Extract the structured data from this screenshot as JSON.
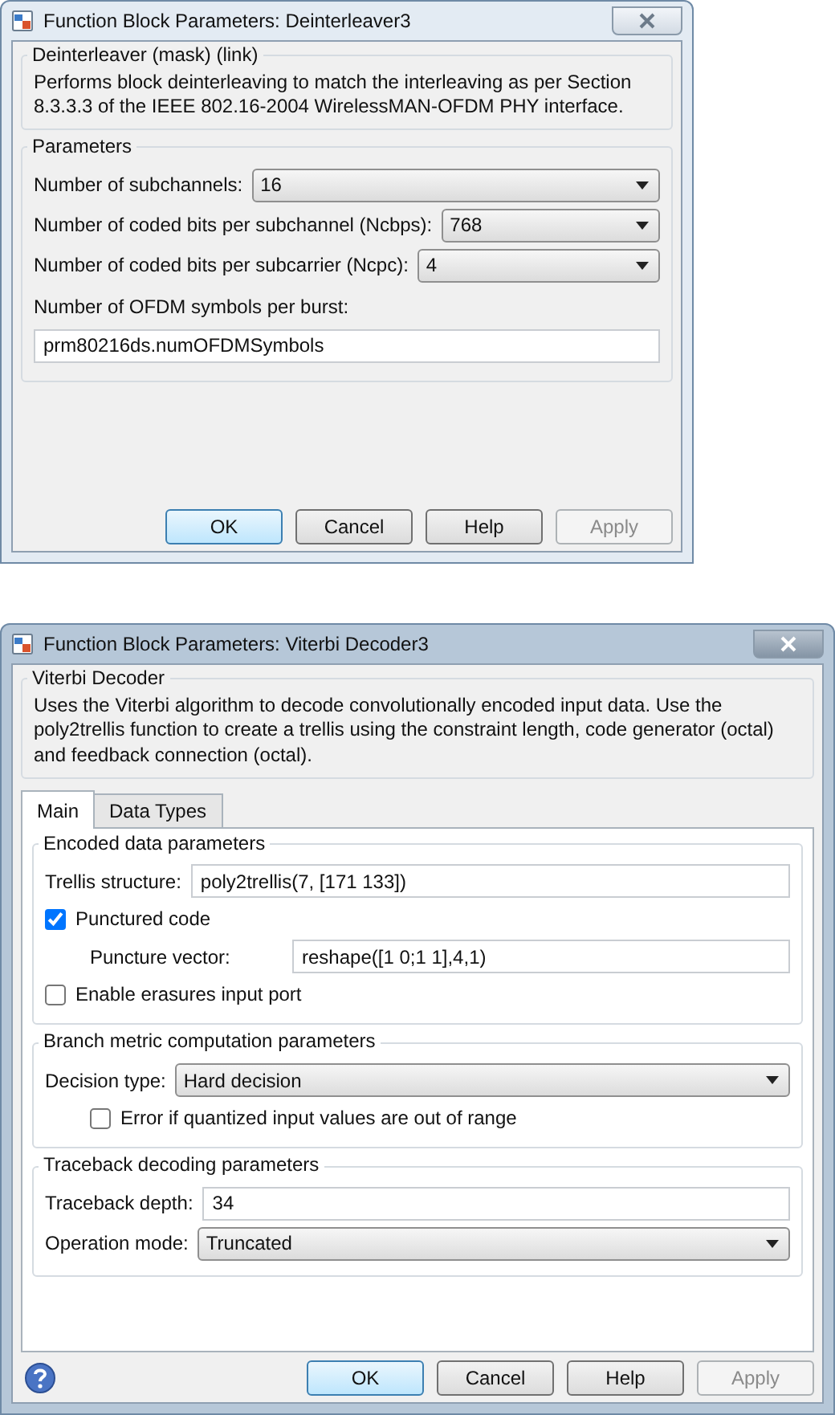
{
  "dialogs": [
    {
      "title": "Function Block Parameters: Deinterleaver3",
      "active": false,
      "description": {
        "title": "Deinterleaver (mask) (link)",
        "text": "Performs block deinterleaving to match the interleaving as per Section 8.3.3.3 of the IEEE 802.16-2004 WirelessMAN-OFDM PHY interface."
      },
      "sections": [
        {
          "title": "Parameters",
          "fields": [
            {
              "kind": "select",
              "label": "Number of subchannels:",
              "value": "16"
            },
            {
              "kind": "select",
              "label": "Number of coded bits per subchannel (Ncbps):",
              "value": "768"
            },
            {
              "kind": "select",
              "label": "Number of coded bits per subcarrier (Ncpc):",
              "value": "4"
            },
            {
              "kind": "stacked",
              "label": "Number of OFDM symbols per burst:",
              "value": "prm80216ds.numOFDMSymbols"
            }
          ]
        }
      ],
      "buttons": [
        {
          "label": "OK",
          "default": true,
          "disabled": false
        },
        {
          "label": "Cancel",
          "default": false,
          "disabled": false
        },
        {
          "label": "Help",
          "default": false,
          "disabled": false
        },
        {
          "label": "Apply",
          "default": false,
          "disabled": true
        }
      ]
    },
    {
      "title": "Function Block Parameters: Viterbi Decoder3",
      "active": true,
      "help_icon": true,
      "description": {
        "title": "Viterbi Decoder",
        "text": "Uses the Viterbi algorithm to decode convolutionally encoded input data.  Use the poly2trellis function to create a trellis using the constraint length, code generator (octal) and feedback connection (octal)."
      },
      "tabs": [
        {
          "label": "Main",
          "selected": true
        },
        {
          "label": "Data Types",
          "selected": false
        }
      ],
      "sections": [
        {
          "title": "Encoded data parameters",
          "fields": [
            {
              "kind": "text",
              "label": "Trellis structure:",
              "value": "poly2trellis(7, [171 133])"
            },
            {
              "kind": "checkbox",
              "label": "Punctured code",
              "checked": true,
              "children": [
                {
                  "kind": "text",
                  "label": "Puncture vector:",
                  "value": "reshape([1 0;1 1],4,1)"
                }
              ]
            },
            {
              "kind": "checkbox",
              "label": "Enable erasures input port",
              "checked": false
            }
          ]
        },
        {
          "title": "Branch metric computation parameters",
          "fields": [
            {
              "kind": "select",
              "label": "Decision type:",
              "value": "Hard decision",
              "children": [
                {
                  "kind": "checkbox",
                  "label": "Error if quantized input values are out of range",
                  "checked": false
                }
              ]
            }
          ]
        },
        {
          "title": "Traceback decoding parameters",
          "fields": [
            {
              "kind": "text",
              "label": "Traceback depth:",
              "value": "34"
            },
            {
              "kind": "select",
              "label": "Operation mode:",
              "value": "Truncated"
            }
          ]
        }
      ],
      "buttons": [
        {
          "label": "OK",
          "default": true,
          "disabled": false
        },
        {
          "label": "Cancel",
          "default": false,
          "disabled": false
        },
        {
          "label": "Help",
          "default": false,
          "disabled": false
        },
        {
          "label": "Apply",
          "default": false,
          "disabled": true
        }
      ]
    }
  ]
}
